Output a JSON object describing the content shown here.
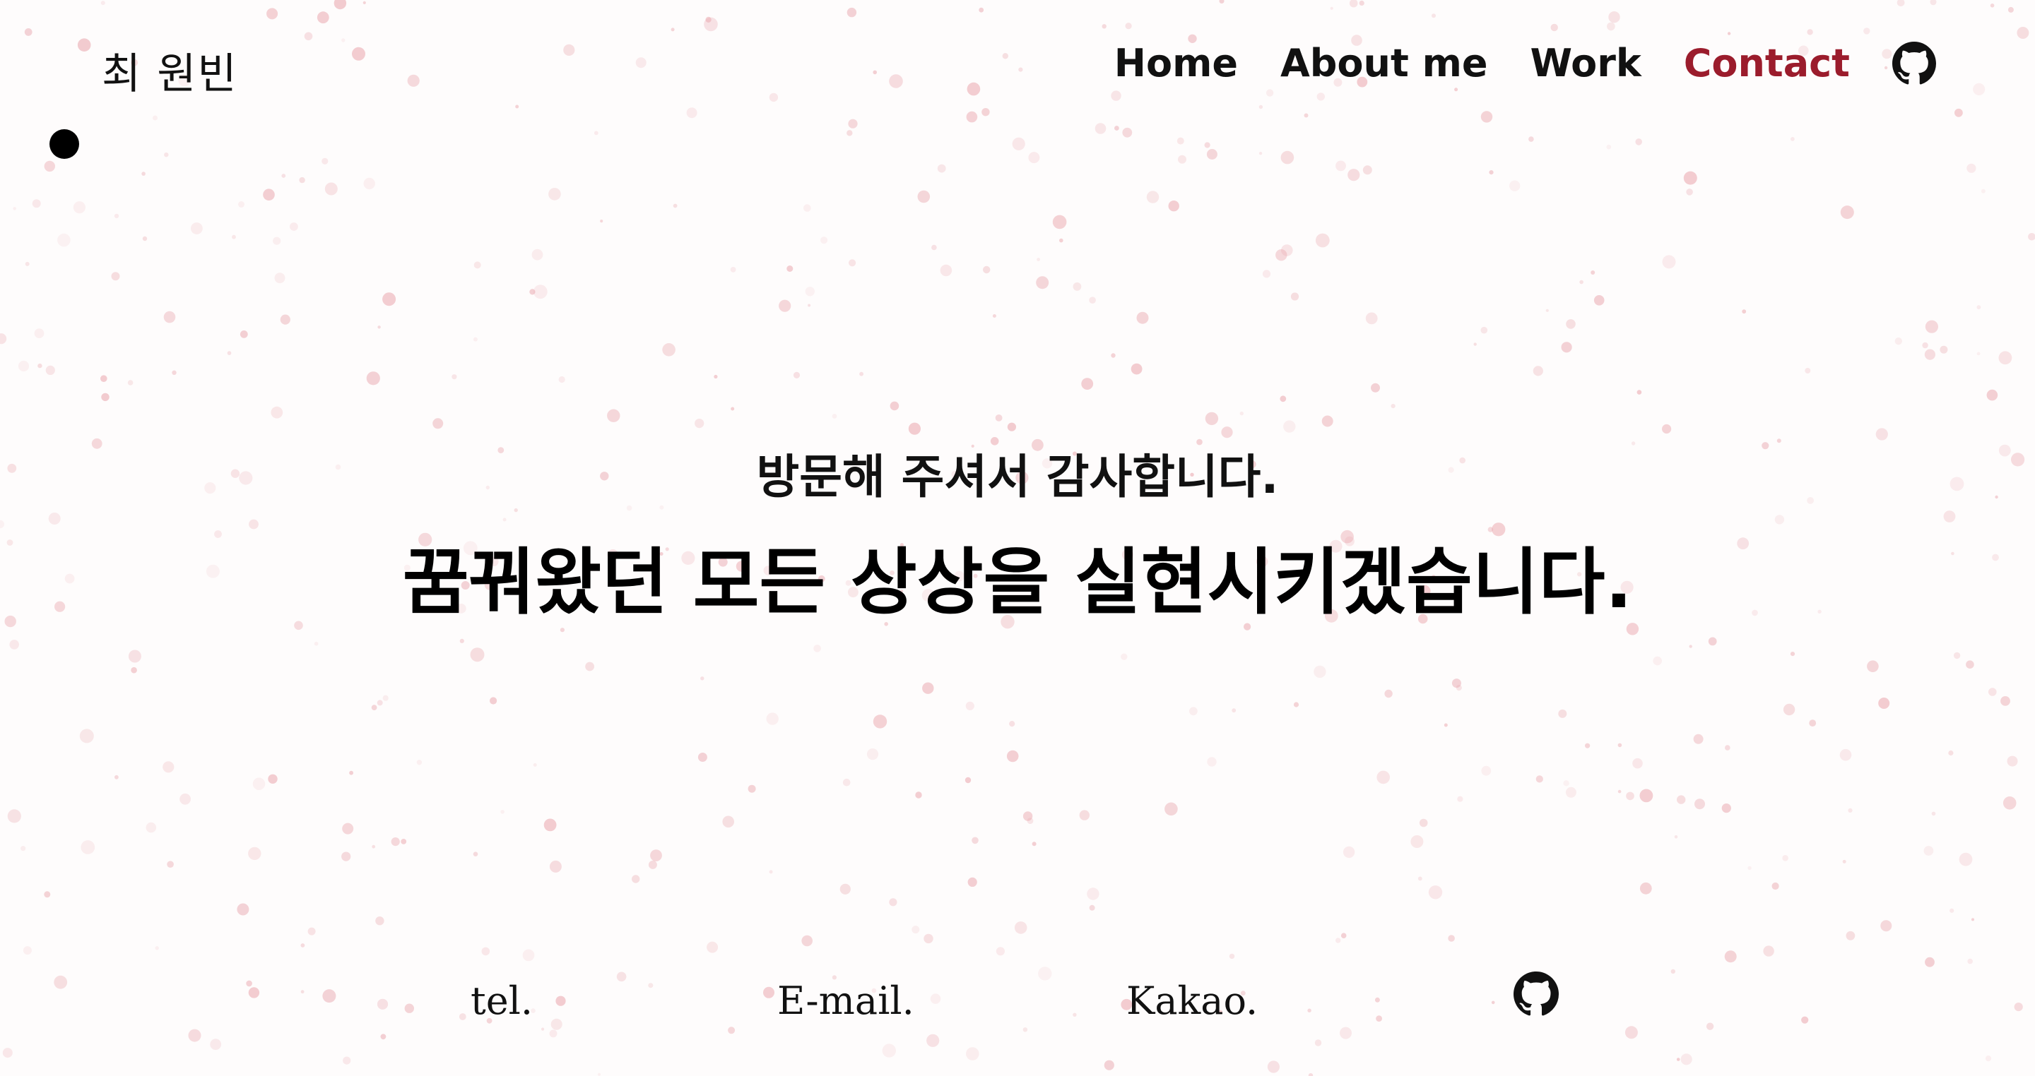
{
  "header": {
    "logo": "최 원빈",
    "nav": [
      {
        "label": "Home",
        "active": false
      },
      {
        "label": "About me",
        "active": false
      },
      {
        "label": "Work",
        "active": false
      },
      {
        "label": "Contact",
        "active": true
      }
    ],
    "github_icon": "github-icon"
  },
  "hero": {
    "subtitle": "방문해 주셔서 감사합니다.",
    "title": "꿈꿔왔던 모든 상상을 실현시키겠습니다."
  },
  "footer": {
    "tel": "tel.",
    "email": "E-mail.",
    "kakao": "Kakao.",
    "github_icon": "github-icon"
  },
  "colors": {
    "background": "#fefcfc",
    "accent": "#9b1c2c",
    "text": "#111111",
    "dots": "#e9a6ad"
  }
}
